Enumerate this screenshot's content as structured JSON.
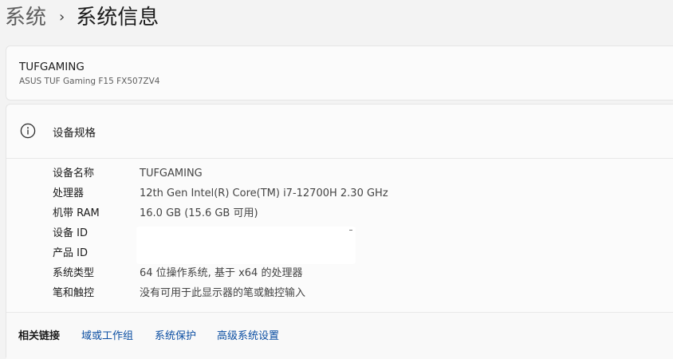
{
  "breadcrumb": {
    "parent": "系统",
    "separator": "›",
    "current": "系统信息"
  },
  "device": {
    "name": "TUFGAMING",
    "model": "ASUS TUF Gaming F15 FX507ZV4"
  },
  "specs": {
    "title": "设备规格",
    "icon": "info-icon",
    "rows": [
      {
        "label": "设备名称",
        "value": "TUFGAMING"
      },
      {
        "label": "处理器",
        "value": "12th Gen Intel(R) Core(TM) i7-12700H   2.30 GHz"
      },
      {
        "label": "机带 RAM",
        "value": "16.0 GB (15.6 GB 可用)"
      },
      {
        "label": "设备 ID",
        "value": ""
      },
      {
        "label": "产品 ID",
        "value": ""
      },
      {
        "label": "系统类型",
        "value": "64 位操作系统, 基于 x64 的处理器"
      },
      {
        "label": "笔和触控",
        "value": "没有可用于此显示器的笔或触控输入"
      }
    ]
  },
  "related_links": {
    "title": "相关链接",
    "links": [
      {
        "label": "域或工作组"
      },
      {
        "label": "系统保护"
      },
      {
        "label": "高级系统设置"
      }
    ]
  },
  "colors": {
    "background": "#f3f3f3",
    "card": "#fbfbfb",
    "link": "#0b4ea2"
  }
}
